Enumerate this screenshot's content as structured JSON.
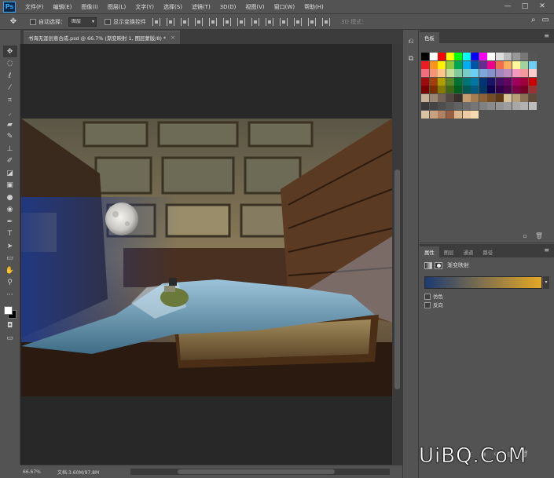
{
  "app": {
    "logo": "Ps",
    "menu": [
      "文件(F)",
      "编辑(E)",
      "图像(I)",
      "图层(L)",
      "文字(Y)",
      "选择(S)",
      "滤镜(T)",
      "3D(D)",
      "视图(V)",
      "窗口(W)",
      "帮助(H)"
    ],
    "window_controls": [
      "—",
      "□",
      "✕"
    ]
  },
  "options_bar": {
    "tool_icon": "move-tool-icon",
    "auto_select_label": "自动选择：",
    "auto_select_value": "图层",
    "show_transform_label": "显示变换控件",
    "mode_3d_label": "3D 模式："
  },
  "document": {
    "tab_title": "书海无涯创意合成.psd @ 66.7% (渐变映射 1, 图层蒙版/8) *",
    "zoom": "66.67%",
    "doc_size": "文档:3.60M/97.8M"
  },
  "tools": [
    "move-tool-icon",
    "marquee-tool-icon",
    "lasso-tool-icon",
    "magic-wand-tool-icon",
    "crop-tool-icon",
    "eyedropper-tool-icon",
    "healing-brush-tool-icon",
    "brush-tool-icon",
    "clone-stamp-tool-icon",
    "history-brush-tool-icon",
    "eraser-tool-icon",
    "gradient-tool-icon",
    "blur-tool-icon",
    "dodge-tool-icon",
    "pen-tool-icon",
    "type-tool-icon",
    "path-selection-tool-icon",
    "rectangle-tool-icon",
    "hand-tool-icon",
    "zoom-tool-icon",
    "more-tools-icon"
  ],
  "swatches_panel": {
    "tab": "色板"
  },
  "properties_panel": {
    "tabs": [
      "属性",
      "图层",
      "通道",
      "路径"
    ],
    "adjustment_title": "渐变映射",
    "gradient_colors": [
      "#1d3a72",
      "#e6a825"
    ],
    "dither_label": "仿色",
    "reverse_label": "反向"
  },
  "colors": {
    "foreground": "#ffffff",
    "background": "#000000"
  },
  "watermark": "UiBQ.CoM"
}
